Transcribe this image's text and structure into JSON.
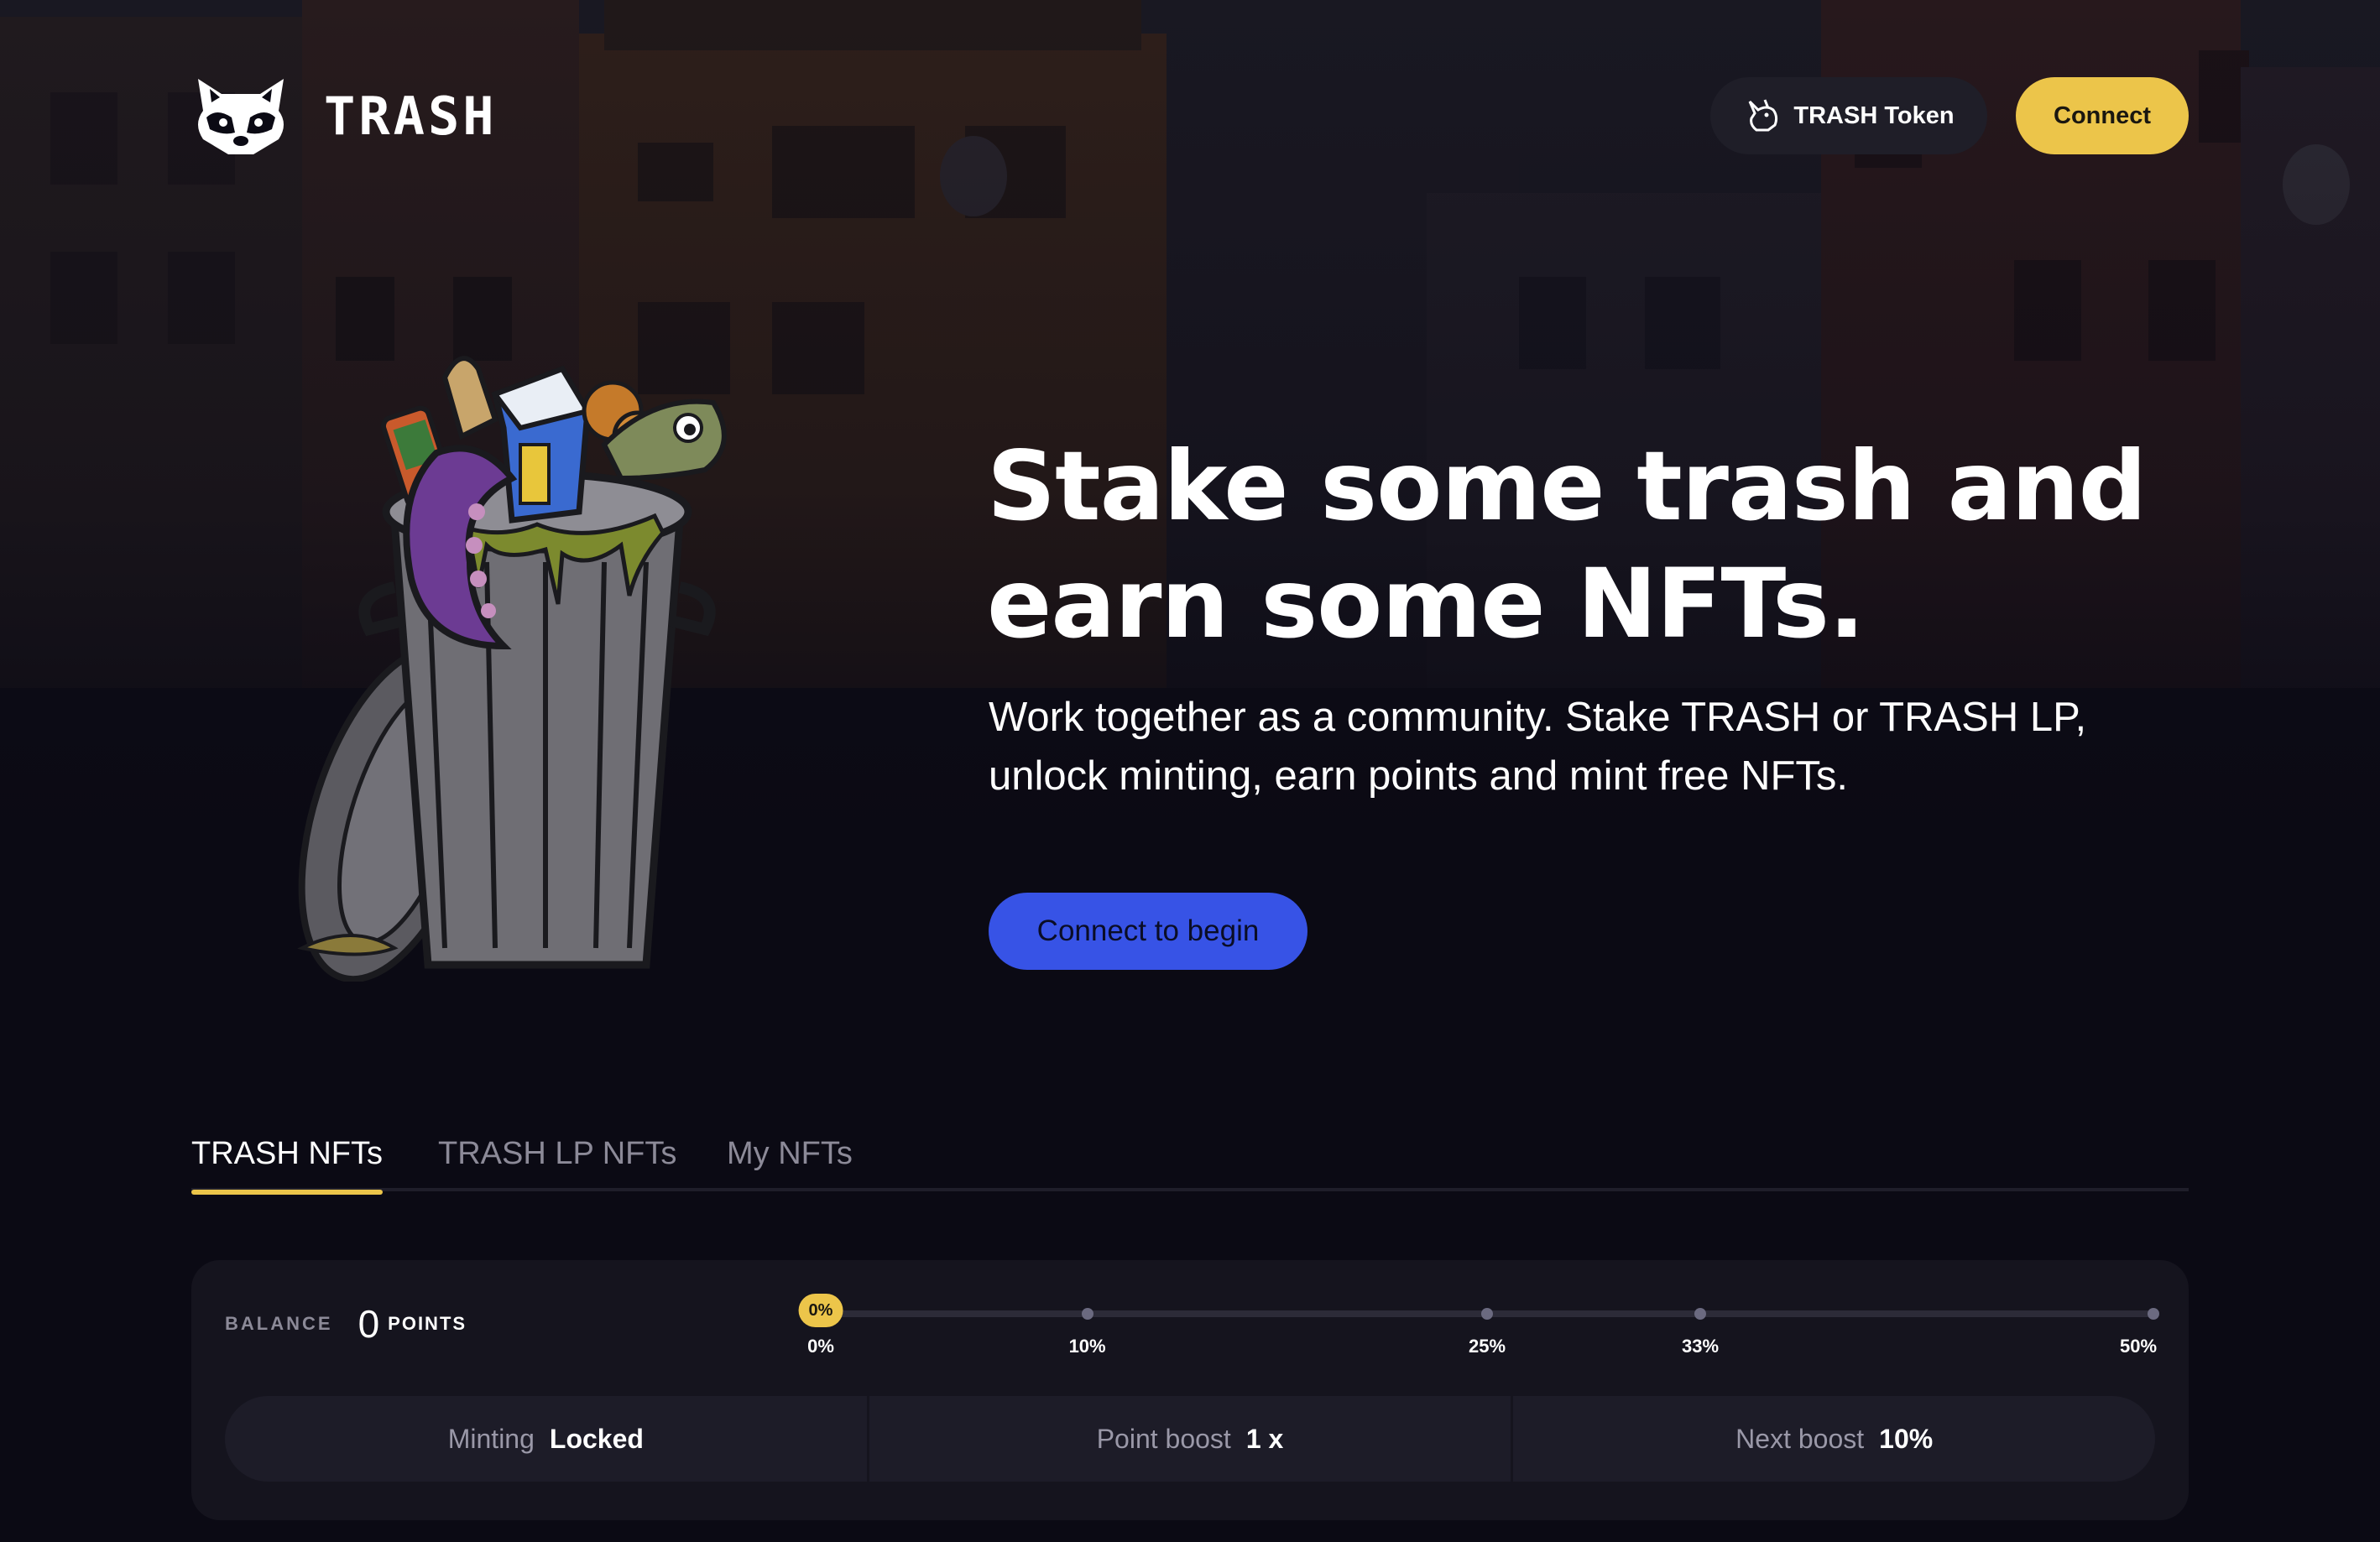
{
  "brand": {
    "name": "TRASH"
  },
  "header": {
    "token_label": "TRASH Token",
    "connect_label": "Connect"
  },
  "hero": {
    "title_line1": "Stake some trash and",
    "title_line2": "earn some NFTs.",
    "subtitle_line1": "Work together as a community. Stake TRASH or TRASH LP,",
    "subtitle_line2": "unlock minting, earn points and mint free NFTs.",
    "cta_label": "Connect to begin"
  },
  "tabs": [
    {
      "label": "TRASH NFTs",
      "active": true
    },
    {
      "label": "TRASH LP NFTs",
      "active": false
    },
    {
      "label": "My NFTs",
      "active": false
    }
  ],
  "points": {
    "balance_label": "BALANCE",
    "balance_value": "0",
    "balance_unit": "POINTS",
    "progress_label": "0%",
    "progress_percent": 0,
    "max_percent": 50,
    "ticks": [
      {
        "value": 0,
        "label": "0%"
      },
      {
        "value": 10,
        "label": "10%"
      },
      {
        "value": 25,
        "label": "25%"
      },
      {
        "value": 33,
        "label": "33%"
      },
      {
        "value": 50,
        "label": "50%"
      }
    ]
  },
  "stats": [
    {
      "label": "Minting",
      "value": "Locked"
    },
    {
      "label": "Point boost",
      "value": "1 x"
    },
    {
      "label": "Next boost",
      "value": "10%"
    }
  ],
  "colors": {
    "accent_yellow": "#ecc54a",
    "accent_blue": "#3753e6",
    "background": "#0b0a14",
    "panel": "#15141e"
  },
  "icons": {
    "logo": "raccoon-icon",
    "token": "unicorn-icon",
    "hero": "trash-can-illustration"
  }
}
